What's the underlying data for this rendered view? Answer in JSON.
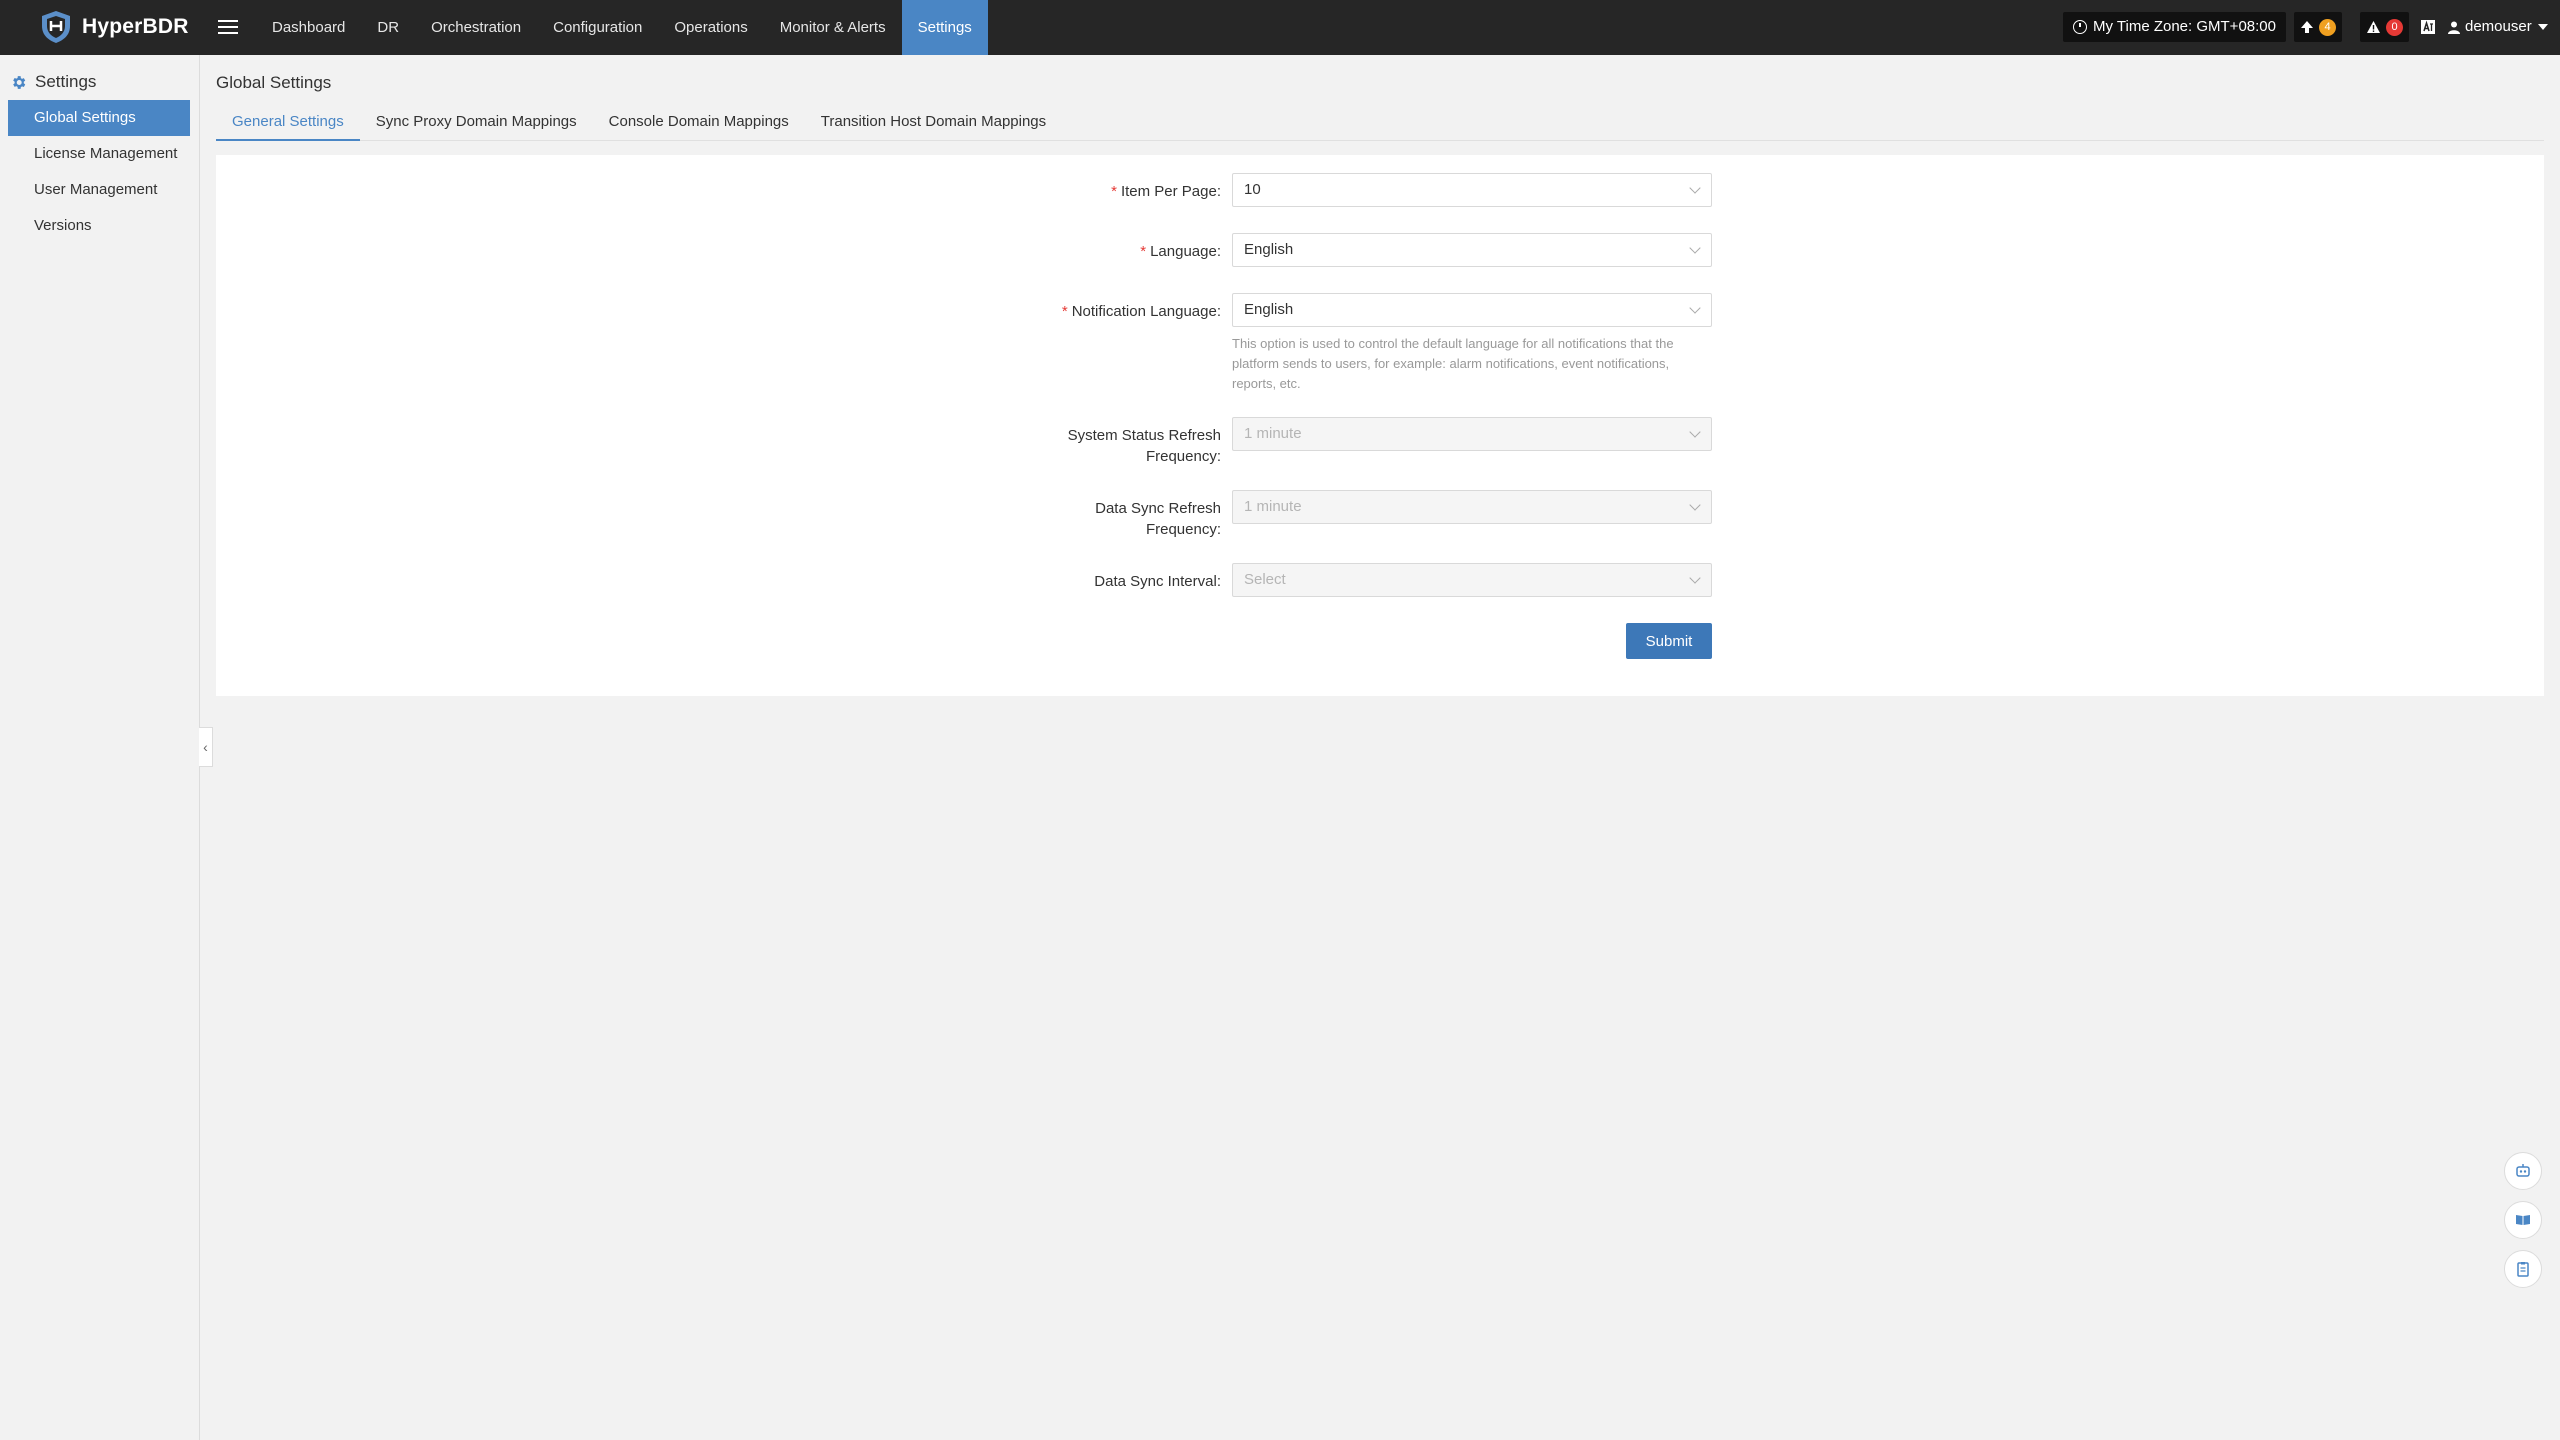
{
  "brand": {
    "name": "HyperBDR",
    "accent": "#4a86c5"
  },
  "nav": {
    "items": [
      {
        "label": "Dashboard"
      },
      {
        "label": "DR"
      },
      {
        "label": "Orchestration"
      },
      {
        "label": "Configuration"
      },
      {
        "label": "Operations"
      },
      {
        "label": "Monitor & Alerts"
      },
      {
        "label": "Settings"
      }
    ],
    "active": "Settings"
  },
  "header": {
    "timezone": "My Time Zone: GMT+08:00",
    "upgrade_count": "4",
    "alert_count": "0",
    "username": "demouser"
  },
  "sidebar": {
    "title": "Settings",
    "items": [
      {
        "label": "Global Settings"
      },
      {
        "label": "License Management"
      },
      {
        "label": "User Management"
      },
      {
        "label": "Versions"
      }
    ]
  },
  "page": {
    "title": "Global Settings"
  },
  "tabs": [
    {
      "label": "General Settings"
    },
    {
      "label": "Sync Proxy Domain Mappings"
    },
    {
      "label": "Console Domain Mappings"
    },
    {
      "label": "Transition Host Domain Mappings"
    }
  ],
  "form": {
    "item_per_page": {
      "label": "Item Per Page:",
      "value": "10",
      "required": true
    },
    "language": {
      "label": "Language:",
      "value": "English",
      "required": true
    },
    "notification_language": {
      "label": "Notification Language:",
      "value": "English",
      "required": true,
      "help": "This option is used to control the default language for all notifications that the platform sends to users, for example: alarm notifications, event notifications, reports, etc."
    },
    "system_status_refresh": {
      "label_line1": "System Status Refresh",
      "label_line2": "Frequency:",
      "value": "1 minute",
      "disabled": true
    },
    "data_sync_refresh": {
      "label_line1": "Data Sync Refresh",
      "label_line2": "Frequency:",
      "value": "1 minute",
      "disabled": true
    },
    "data_sync_interval": {
      "label": "Data Sync Interval:",
      "placeholder": "Select",
      "disabled": true
    },
    "submit_label": "Submit"
  },
  "icons": {
    "logo": "shield-icon",
    "menu": "hamburger-icon",
    "upgrade": "arrow-up-icon",
    "alert": "warning-icon",
    "lang": "language-icon",
    "user": "user-icon",
    "settings": "gear-icon",
    "fabs": [
      "robot-icon",
      "book-icon",
      "clipboard-icon"
    ]
  }
}
